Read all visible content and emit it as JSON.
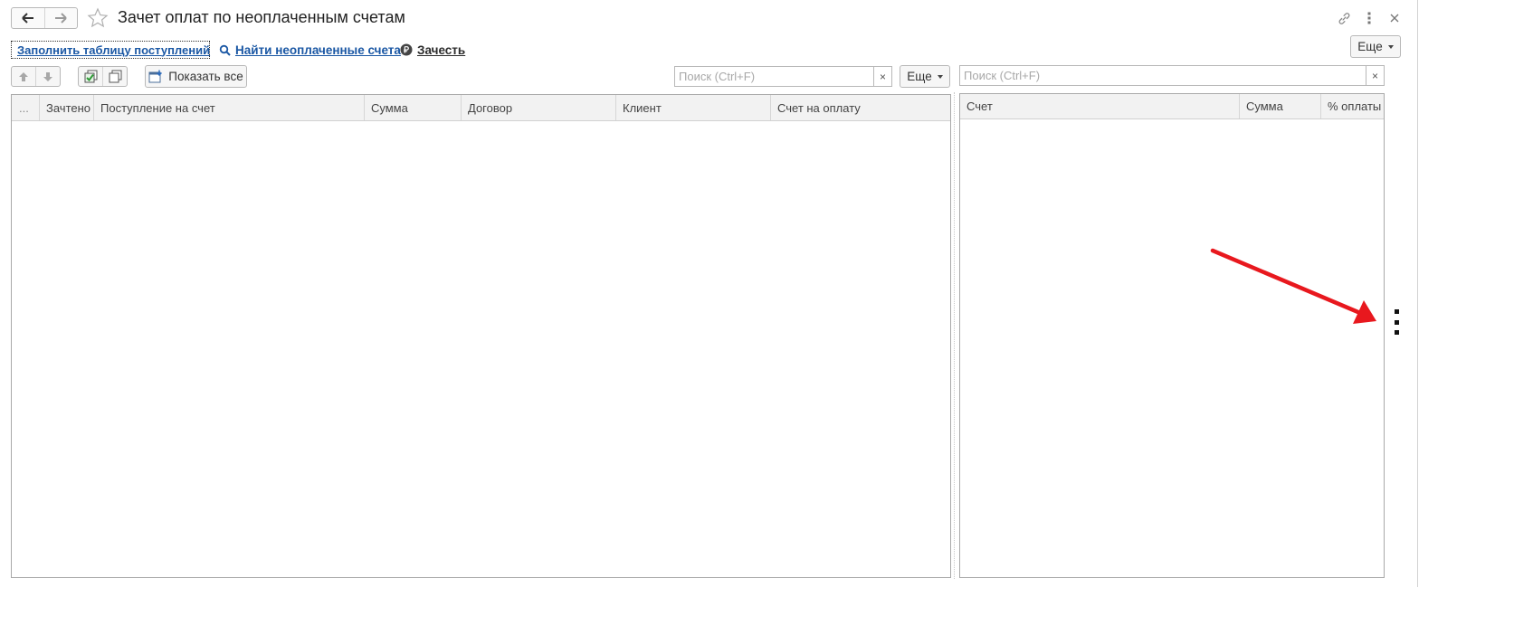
{
  "window": {
    "title": "Зачет оплат по неоплаченным счетам",
    "icons": [
      "back-arrow-icon",
      "forward-arrow-icon",
      "favorite-star-icon",
      "link-icon",
      "more-vertical-icon",
      "close-icon"
    ]
  },
  "commands": {
    "fill_table": "Заполнить таблицу поступлений",
    "find_unpaid": "Найти неоплаченные счета",
    "offset": "Зачесть",
    "more": "Еще"
  },
  "left_panel": {
    "show_all": "Показать все",
    "search_placeholder": "Поиск (Ctrl+F)",
    "more": "Еще",
    "columns": [
      "...",
      "Зачтено",
      "Поступление на счет",
      "Сумма",
      "Договор",
      "Клиент",
      "Счет на оплату"
    ],
    "rows": []
  },
  "right_panel": {
    "search_placeholder": "Поиск (Ctrl+F)",
    "columns": [
      "Счет",
      "Сумма",
      "% оплаты"
    ],
    "rows": []
  },
  "colors": {
    "link": "#1a57a4",
    "annotation_arrow": "#e8181e",
    "border": "#a9a9a9",
    "header_bg": "#f2f2f2"
  }
}
